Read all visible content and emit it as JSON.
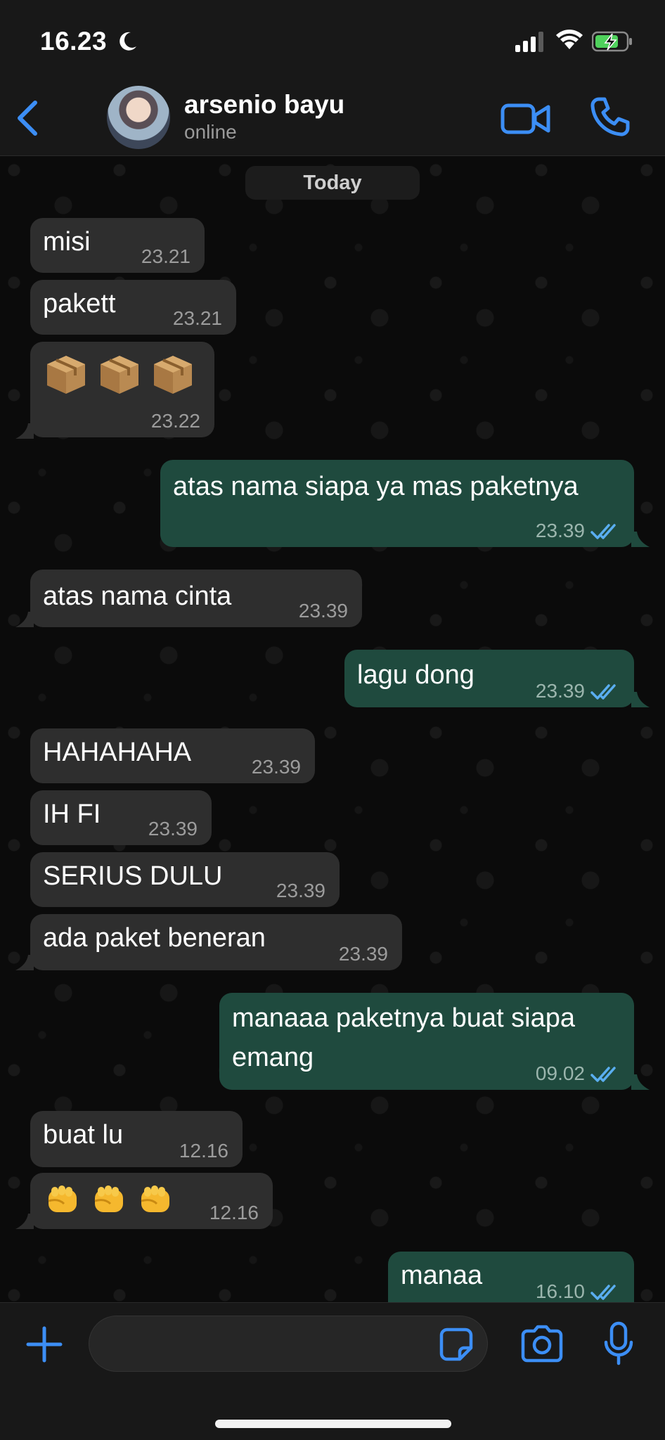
{
  "status_bar": {
    "time": "16.23"
  },
  "header": {
    "contact_name": "arsenio bayu",
    "contact_status": "online"
  },
  "chat": {
    "date_label": "Today",
    "messages": [
      {
        "side": "in",
        "text": "misi",
        "time": "23.21"
      },
      {
        "side": "in",
        "text": "pakett",
        "time": "23.21"
      },
      {
        "side": "in",
        "text": "📦📦📦",
        "time": "23.22"
      },
      {
        "side": "out",
        "text": "atas nama siapa ya mas paketnya",
        "time": "23.39"
      },
      {
        "side": "in",
        "text": "atas nama cinta",
        "time": "23.39"
      },
      {
        "side": "out",
        "text": "lagu dong",
        "time": "23.39"
      },
      {
        "side": "in",
        "text": "HAHAHAHA",
        "time": "23.39"
      },
      {
        "side": "in",
        "text": "IH FI",
        "time": "23.39"
      },
      {
        "side": "in",
        "text": "SERIUS DULU",
        "time": "23.39"
      },
      {
        "side": "in",
        "text": "ada paket beneran",
        "time": "23.39"
      },
      {
        "side": "out",
        "text_line1": "manaaa paketnya buat siapa",
        "text_line2": "emang",
        "time": "09.02"
      },
      {
        "side": "in",
        "text": "buat lu",
        "time": "12.16"
      },
      {
        "side": "in",
        "text": "👊👊👊",
        "time": "12.16"
      },
      {
        "side": "out",
        "text": "manaa",
        "time": "16.10"
      }
    ]
  },
  "input": {
    "value": ""
  },
  "colors": {
    "accent": "#3c8ef5",
    "incoming_bubble": "#2e2e2e",
    "outgoing_bubble": "#1f4a3e",
    "read_ticks": "#5aaef0"
  }
}
